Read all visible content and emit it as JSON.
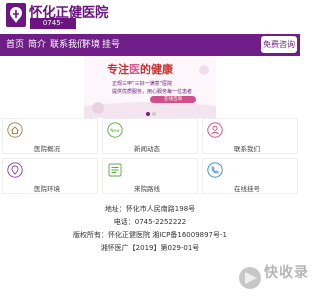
{
  "header": {
    "logo_name": "怀化正健医院",
    "phone": "0745-2252222"
  },
  "nav": {
    "items": [
      {
        "label": "首页"
      },
      {
        "label": "简介"
      },
      {
        "label": "联系我们"
      },
      {
        "label": "环境"
      },
      {
        "label": "挂号"
      }
    ],
    "consult_label": "免费咨询"
  },
  "banner": {
    "headline_a": "专注",
    "headline_b": "医",
    "headline_c": "的健康",
    "line2": "正规三甲“三好一满意”医院",
    "line3": "提供优质服务，用心服务每一位患者",
    "button": "在线咨询"
  },
  "grid": {
    "items": [
      {
        "label": "医院概况",
        "icon": "home-icon"
      },
      {
        "label": "新闻动态",
        "icon": "news-icon"
      },
      {
        "label": "联系我们",
        "icon": "contact-icon"
      },
      {
        "label": "医院环境",
        "icon": "environment-icon"
      },
      {
        "label": "来院路线",
        "icon": "route-icon"
      },
      {
        "label": "在线挂号",
        "icon": "phone-icon"
      }
    ]
  },
  "footer": {
    "address": "地址：怀化市人民南路198号",
    "tel": "电话：0745-2252222",
    "copyright": "版权所有：怀化正健医院 湘ICP备16009897号-1",
    "icp": "湘怀医广【2019】第029-01号"
  },
  "watermark": {
    "text": "快收录"
  },
  "colors": {
    "brand": "#6e1e86",
    "accent_pink": "#d14f8a",
    "accent_red": "#cc2f2f"
  }
}
